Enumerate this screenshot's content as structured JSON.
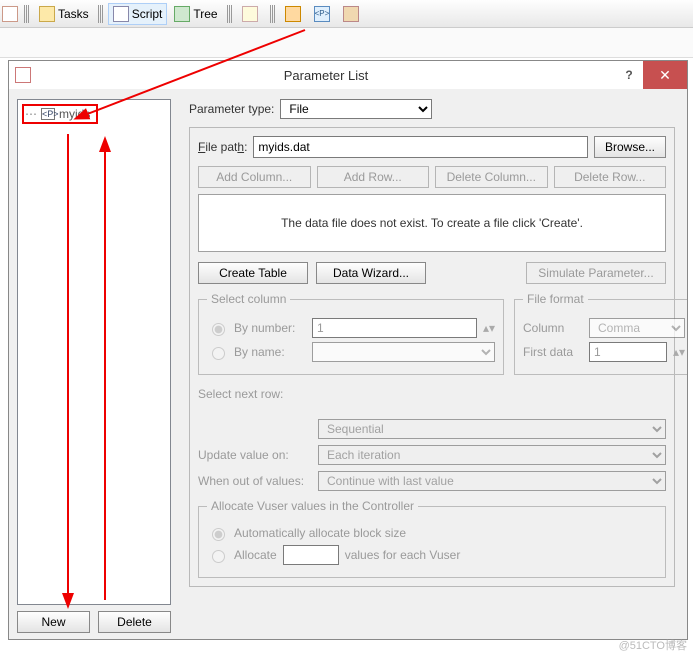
{
  "ribbon": {
    "tasks": "Tasks",
    "script": "Script",
    "tree": "Tree"
  },
  "dialog": {
    "title": "Parameter List",
    "help": "?",
    "close": "✕"
  },
  "tree": {
    "node": "myids",
    "new_btn": "New",
    "delete_btn": "Delete"
  },
  "param": {
    "type_label": "Parameter type:",
    "type_value": "File",
    "path_label": "File path:",
    "path_value": "myids.dat",
    "browse": "Browse...",
    "add_col": "Add Column...",
    "add_row": "Add Row...",
    "del_col": "Delete Column...",
    "del_row": "Delete Row...",
    "msg": "The data file does not exist. To create a file click 'Create'.",
    "create_table": "Create Table",
    "data_wizard": "Data Wizard...",
    "simulate": "Simulate Parameter..."
  },
  "selcol": {
    "legend": "Select column",
    "by_number": "By number:",
    "by_number_val": "1",
    "by_name": "By name:"
  },
  "fileformat": {
    "legend": "File format",
    "column": "Column",
    "column_val": "Comma",
    "first": "First data",
    "first_val": "1"
  },
  "nextrow": {
    "label": "Select next row:",
    "value": "Sequential",
    "update_label": "Update value on:",
    "update_value": "Each iteration",
    "out_label": "When out of values:",
    "out_value": "Continue with last value"
  },
  "allocate": {
    "legend": "Allocate Vuser values in the Controller",
    "auto": "Automatically allocate block size",
    "manual": "Allocate",
    "suffix": "values for each Vuser"
  },
  "watermark": "@51CTO博客"
}
